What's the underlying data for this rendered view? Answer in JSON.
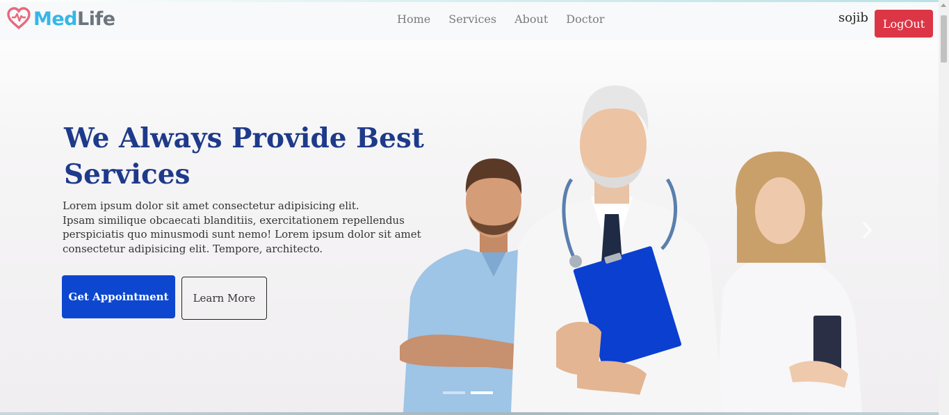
{
  "brand": {
    "name_part1": "Med",
    "name_part2": "Life",
    "icon": "heart-pulse-icon",
    "colors": {
      "icon": "#e56a7d",
      "med": "#36b6e8",
      "life": "#6c757d"
    }
  },
  "nav": {
    "items": [
      {
        "label": "Home"
      },
      {
        "label": "Services"
      },
      {
        "label": "About"
      },
      {
        "label": "Doctor"
      }
    ]
  },
  "user": {
    "name": "sojib",
    "logout_label": "LogOut"
  },
  "hero": {
    "title": "We Always Provide Best Services",
    "text_lines": [
      "Lorem ipsum dolor sit amet consectetur adipisicing elit.",
      "Ipsam similique obcaecati blanditiis, exercitationem repellendus",
      "perspiciatis quo minusmodi sunt nemo! Lorem ipsum dolor sit amet",
      "consectetur adipisicing elit. Tempore, architecto."
    ],
    "primary_button": "Get Appointment",
    "secondary_button": "Learn More",
    "image": "three-doctors-photo"
  },
  "carousel": {
    "slides": 2,
    "active_index": 1
  },
  "colors": {
    "title": "#1e3a8a",
    "primary_button": "#0d47cf",
    "logout": "#dc3545"
  }
}
